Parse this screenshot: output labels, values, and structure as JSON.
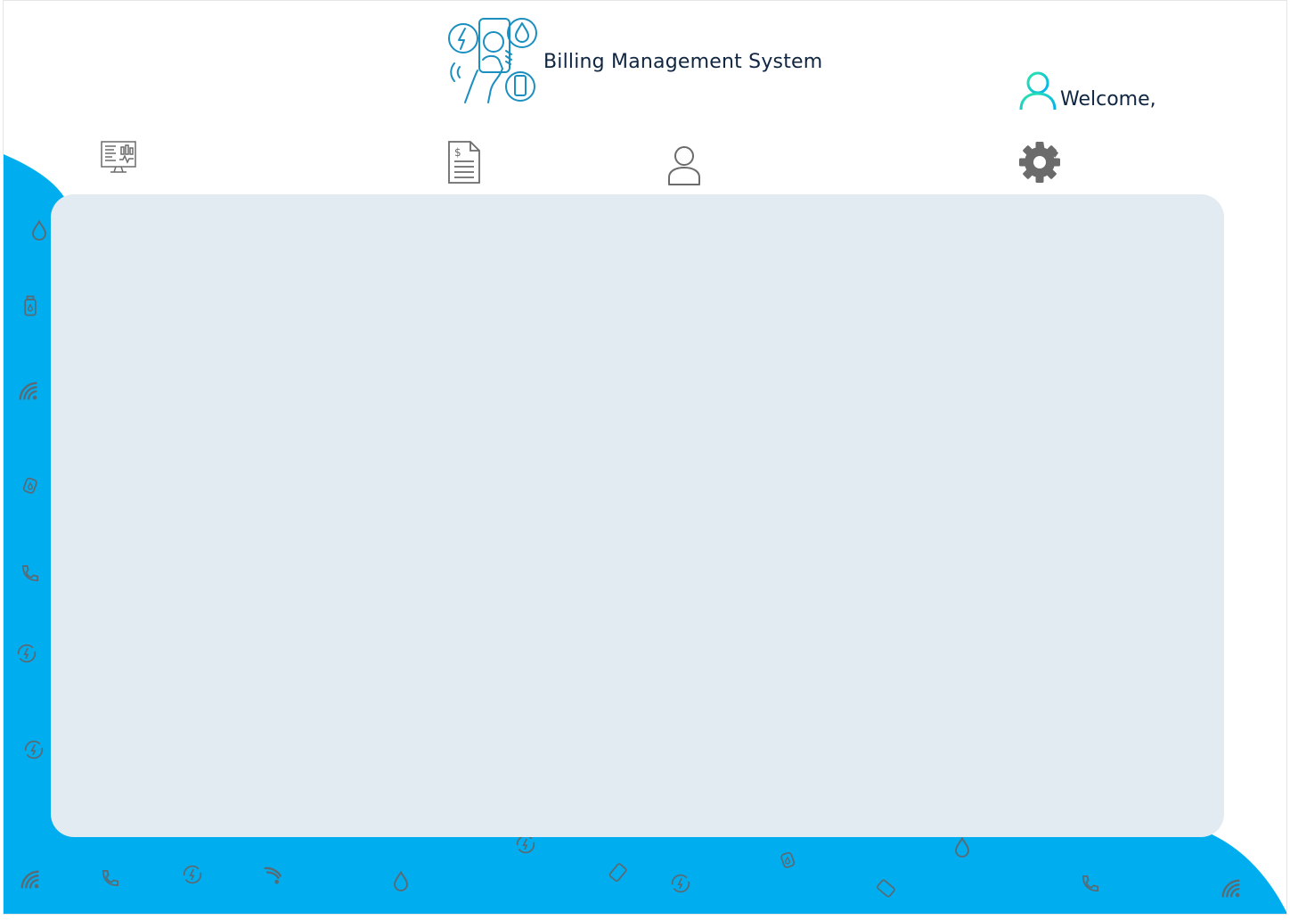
{
  "header": {
    "title": "Billing Management System",
    "welcome": "Welcome,",
    "logo_icon": "utility-billing-phone-icon",
    "avatar_icon": "user-avatar-icon"
  },
  "nav": {
    "items": [
      {
        "name": "dashboard",
        "icon": "monitor-dashboard-icon"
      },
      {
        "name": "billing",
        "icon": "invoice-document-icon"
      },
      {
        "name": "users",
        "icon": "user-profile-icon"
      },
      {
        "name": "settings",
        "icon": "gear-icon"
      }
    ]
  },
  "colors": {
    "accent_blue": "#00aeef",
    "panel_bg": "#e2ebf1",
    "title_text": "#0f2540",
    "icon_gray": "#6b6b6b",
    "avatar_gradient_start": "#2ee6a8",
    "avatar_gradient_end": "#00aeef"
  }
}
